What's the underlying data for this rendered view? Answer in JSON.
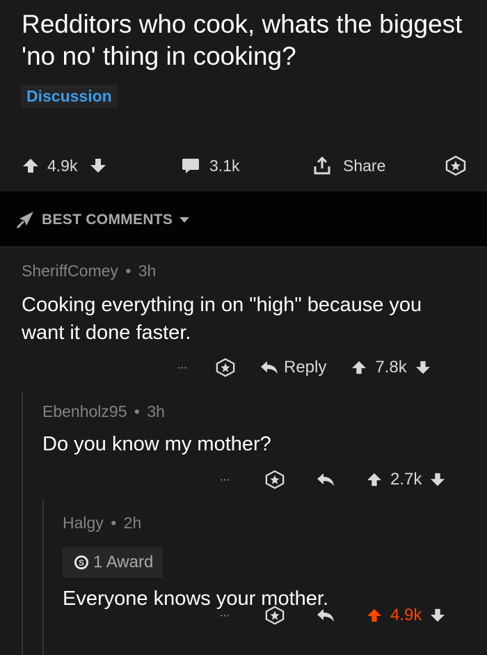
{
  "post": {
    "title": "Redditors who cook, whats the biggest 'no no' thing in cooking?",
    "flair": "Discussion",
    "score": "4.9k",
    "comment_count": "3.1k",
    "share_label": "Share"
  },
  "sort": {
    "label": "BEST COMMENTS"
  },
  "comments": [
    {
      "author": "SheriffComey",
      "time": "3h",
      "text": "Cooking everything in on \"high\" because you want it done faster.",
      "reply_label": "Reply",
      "score": "7.8k",
      "more": "···"
    },
    {
      "author": "Ebenholz95",
      "time": "3h",
      "text": "Do you know my mother?",
      "score": "2.7k",
      "more": "···"
    },
    {
      "author": "Halgy",
      "time": "2h",
      "award": "1 Award",
      "text": "Everyone knows your mother.",
      "score": "4.9k",
      "more": "···",
      "score_color": "#ff4500"
    }
  ],
  "separator": "•",
  "colors": {
    "background": "#1a1a1b",
    "sort_bar": "#030303",
    "flair": "#3d9be9",
    "upvoted": "#ff4500"
  },
  "icons": [
    "upvote-icon",
    "downvote-icon",
    "comment-icon",
    "share-icon",
    "award-icon",
    "reply-icon",
    "best-sort-icon",
    "chevron-down-icon",
    "silver-award-icon"
  ]
}
